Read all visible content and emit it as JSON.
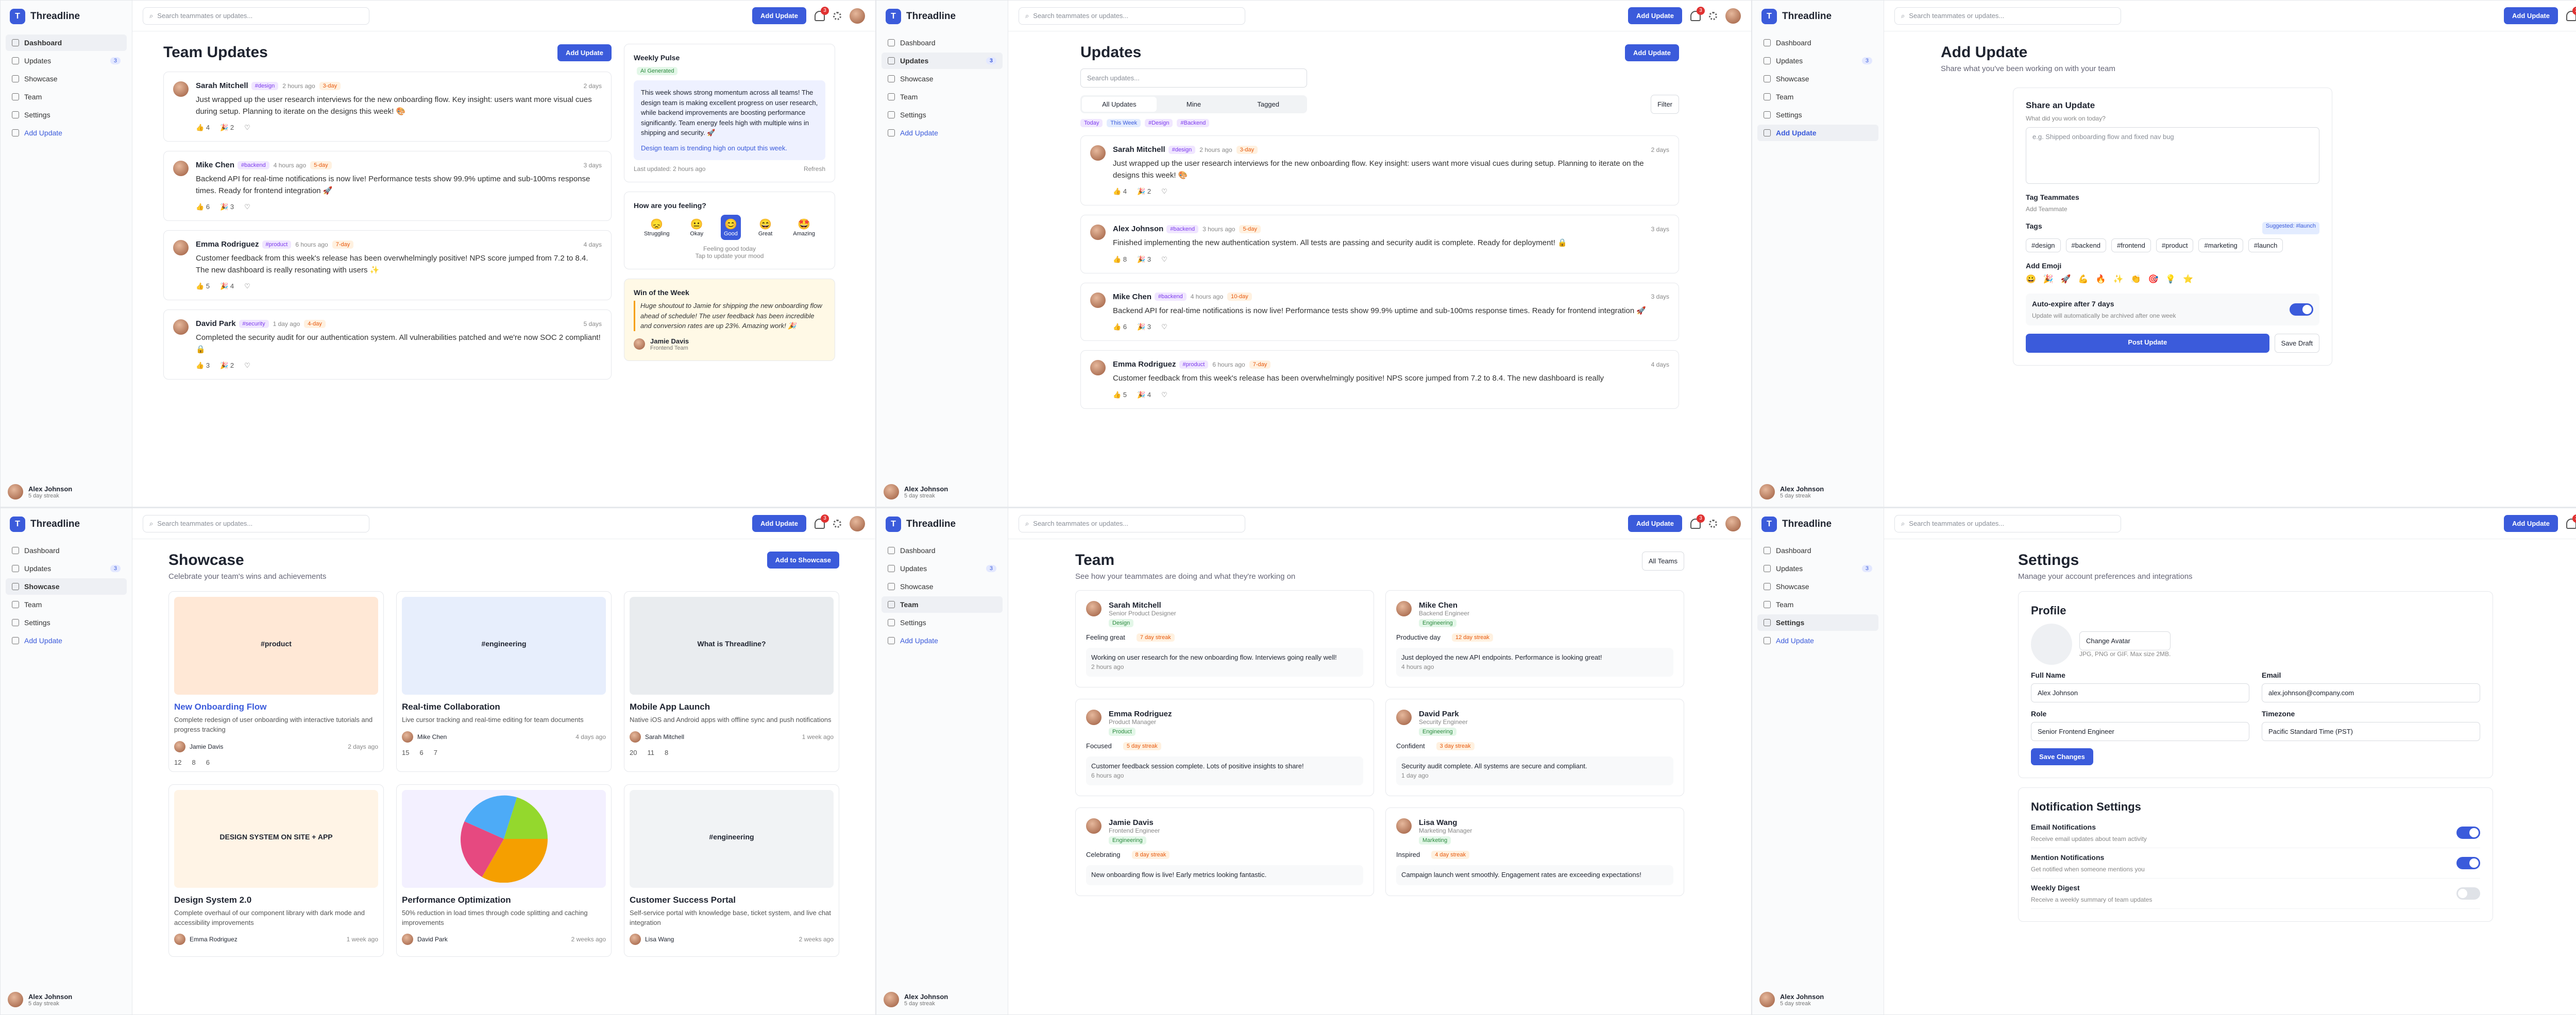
{
  "app": {
    "name": "Threadline",
    "logo_letter": "T",
    "search_placeholder": "Search teammates or updates...",
    "add_update": "Add Update",
    "notif_count": "3",
    "user_name": "Alex Johnson",
    "user_streak": "5 day streak"
  },
  "nav": {
    "items": [
      "Dashboard",
      "Updates",
      "Showcase",
      "Team",
      "Settings"
    ],
    "updates_badge": "3",
    "add": "Add Update"
  },
  "dashboard": {
    "title": "Team Updates",
    "add": "Add Update",
    "posts": [
      {
        "name": "Sarah Mitchell",
        "tag": "#design",
        "time": "2 hours ago",
        "streak": "3-day",
        "ago": "2 days",
        "text": "Just wrapped up the user research interviews for the new onboarding flow. Key insight: users want more visual cues during setup. Planning to iterate on the designs this week! 🎨",
        "r1": "4",
        "r2": "2"
      },
      {
        "name": "Mike Chen",
        "tag": "#backend",
        "time": "4 hours ago",
        "streak": "5-day",
        "ago": "3 days",
        "text": "Backend API for real-time notifications is now live! Performance tests show 99.9% uptime and sub-100ms response times. Ready for frontend integration 🚀",
        "r1": "6",
        "r2": "3"
      },
      {
        "name": "Emma Rodriguez",
        "tag": "#product",
        "time": "6 hours ago",
        "streak": "7-day",
        "ago": "4 days",
        "text": "Customer feedback from this week's release has been overwhelmingly positive! NPS score jumped from 7.2 to 8.4. The new dashboard is really resonating with users ✨",
        "r1": "5",
        "r2": "4"
      },
      {
        "name": "David Park",
        "tag": "#security",
        "time": "1 day ago",
        "streak": "4-day",
        "ago": "5 days",
        "text": "Completed the security audit for our authentication system. All vulnerabilities patched and we're now SOC 2 compliant! 🔒",
        "r1": "3",
        "r2": "2"
      }
    ],
    "pulse": {
      "title": "Weekly Pulse",
      "badge": "AI Generated",
      "text": "This week shows strong momentum across all teams! The design team is making excellent progress on user research, while backend improvements are boosting performance significantly. Team energy feels high with multiple wins in shipping and security. 🚀",
      "trend": "Design team is trending high on output this week.",
      "updated": "Last updated: 2 hours ago",
      "refresh": "Refresh"
    },
    "feeling": {
      "title": "How are you feeling?",
      "options": [
        "Struggling",
        "Okay",
        "Good",
        "Great",
        "Amazing"
      ],
      "caption": "Feeling good today",
      "hint": "Tap to update your mood"
    },
    "win": {
      "title": "Win of the Week",
      "text": "Huge shoutout to Jamie for shipping the new onboarding flow ahead of schedule! The user feedback has been incredible and conversion rates are up 23%. Amazing work! 🎉",
      "name": "Jamie Davis",
      "role": "Frontend Team"
    }
  },
  "updates": {
    "title": "Updates",
    "add": "Add Update",
    "search": "Search updates...",
    "tabs": [
      "All Updates",
      "Mine",
      "Tagged"
    ],
    "filter": "Filter",
    "chips": [
      "Today",
      "This Week",
      "#Design",
      "#Backend"
    ],
    "posts": [
      {
        "name": "Sarah Mitchell",
        "tag": "#design",
        "time": "2 hours ago",
        "streak": "3-day",
        "ago": "2 days",
        "text": "Just wrapped up the user research interviews for the new onboarding flow. Key insight: users want more visual cues during setup. Planning to iterate on the designs this week! 🎨",
        "r1": "4",
        "r2": "2"
      },
      {
        "name": "Alex Johnson",
        "tag": "#backend",
        "time": "3 hours ago",
        "streak": "5-day",
        "ago": "3 days",
        "text": "Finished implementing the new authentication system. All tests are passing and security audit is complete. Ready for deployment! 🔒",
        "r1": "8",
        "r2": "3"
      },
      {
        "name": "Mike Chen",
        "tag": "#backend",
        "time": "4 hours ago",
        "streak": "10-day",
        "ago": "3 days",
        "text": "Backend API for real-time notifications is now live! Performance tests show 99.9% uptime and sub-100ms response times. Ready for frontend integration 🚀",
        "r1": "6",
        "r2": "3"
      },
      {
        "name": "Emma Rodriguez",
        "tag": "#product",
        "time": "6 hours ago",
        "streak": "7-day",
        "ago": "4 days",
        "text": "Customer feedback from this week's release has been overwhelmingly positive! NPS score jumped from 7.2 to 8.4. The new dashboard is really",
        "r1": "5",
        "r2": "4"
      }
    ]
  },
  "add": {
    "title": "Add Update",
    "sub": "Share what you've been working on with your team",
    "card": "Share an Update",
    "q": "What did you work on today?",
    "ph": "e.g. Shipped onboarding flow and fixed nav bug",
    "tag_mates": "Tag Teammates",
    "add_mate": "Add Teammate",
    "tags": "Tags",
    "suggested": "Suggested: #launch",
    "tag_list": [
      "#design",
      "#backend",
      "#frontend",
      "#product",
      "#marketing",
      "#launch"
    ],
    "emoji": "Add Emoji",
    "emojis": [
      "😀",
      "🎉",
      "🚀",
      "💪",
      "🔥",
      "✨",
      "👏",
      "🎯",
      "💡",
      "⭐"
    ],
    "expire": "Auto-expire after 7 days",
    "expire_sub": "Update will automatically be archived after one week",
    "post": "Post Update",
    "draft": "Save Draft"
  },
  "showcase": {
    "title": "Showcase",
    "sub": "Celebrate your team's wins and achievements",
    "add": "Add to Showcase",
    "items": [
      {
        "title": "New Onboarding Flow",
        "desc": "Complete redesign of user onboarding with interactive tutorials and progress tracking",
        "who": "Jamie Davis",
        "ago": "2 days ago",
        "a": "12",
        "b": "8",
        "c": "6",
        "thumb": "#product"
      },
      {
        "title": "Real-time Collaboration",
        "desc": "Live cursor tracking and real-time editing for team documents",
        "who": "Mike Chen",
        "ago": "4 days ago",
        "a": "15",
        "b": "6",
        "c": "7",
        "thumb": "#engineering"
      },
      {
        "title": "Mobile App Launch",
        "desc": "Native iOS and Android apps with offline sync and push notifications",
        "who": "Sarah Mitchell",
        "ago": "1 week ago",
        "a": "20",
        "b": "11",
        "c": "8",
        "thumb": "What is Threadline?"
      },
      {
        "title": "Design System 2.0",
        "desc": "Complete overhaul of our component library with dark mode and accessibility improvements",
        "who": "Emma Rodriguez",
        "ago": "1 week ago",
        "a": "",
        "b": "",
        "c": "",
        "thumb": "DESIGN SYSTEM ON SITE + APP"
      },
      {
        "title": "Performance Optimization",
        "desc": "50% reduction in load times through code splitting and caching improvements",
        "who": "David Park",
        "ago": "2 weeks ago",
        "a": "",
        "b": "",
        "c": "",
        "thumb": ""
      },
      {
        "title": "Customer Success Portal",
        "desc": "Self-service portal with knowledge base, ticket system, and live chat integration",
        "who": "Lisa Wang",
        "ago": "2 weeks ago",
        "a": "",
        "b": "",
        "c": "",
        "thumb": "#engineering"
      }
    ]
  },
  "team": {
    "title": "Team",
    "sub": "See how your teammates are doing and what they're working on",
    "filter": "All Teams",
    "members": [
      {
        "name": "Sarah Mitchell",
        "role": "Senior Product Designer",
        "dept": "Design",
        "mood": "Feeling great",
        "streak": "7 day streak",
        "note": "Working on user research for the new onboarding flow. Interviews going really well!",
        "ago": "2 hours ago"
      },
      {
        "name": "Mike Chen",
        "role": "Backend Engineer",
        "dept": "Engineering",
        "mood": "Productive day",
        "streak": "12 day streak",
        "note": "Just deployed the new API endpoints. Performance is looking great!",
        "ago": "4 hours ago"
      },
      {
        "name": "Emma Rodriguez",
        "role": "Product Manager",
        "dept": "Product",
        "mood": "Focused",
        "streak": "5 day streak",
        "note": "Customer feedback session complete. Lots of positive insights to share!",
        "ago": "6 hours ago"
      },
      {
        "name": "David Park",
        "role": "Security Engineer",
        "dept": "Engineering",
        "mood": "Confident",
        "streak": "3 day streak",
        "note": "Security audit complete. All systems are secure and compliant.",
        "ago": "1 day ago"
      },
      {
        "name": "Jamie Davis",
        "role": "Frontend Engineer",
        "dept": "Engineering",
        "mood": "Celebrating",
        "streak": "8 day streak",
        "note": "New onboarding flow is live! Early metrics looking fantastic.",
        "ago": ""
      },
      {
        "name": "Lisa Wang",
        "role": "Marketing Manager",
        "dept": "Marketing",
        "mood": "Inspired",
        "streak": "4 day streak",
        "note": "Campaign launch went smoothly. Engagement rates are exceeding expectations!",
        "ago": ""
      }
    ]
  },
  "settings": {
    "title": "Settings",
    "sub": "Manage your account preferences and integrations",
    "profile": "Profile",
    "change_avatar": "Change Avatar",
    "avatar_hint": "JPG, PNG or GIF. Max size 2MB.",
    "full_name": "Full Name",
    "full_name_v": "Alex Johnson",
    "email": "Email",
    "email_v": "alex.johnson@company.com",
    "role": "Role",
    "role_v": "Senior Frontend Engineer",
    "tz": "Timezone",
    "tz_v": "Pacific Standard Time (PST)",
    "save": "Save Changes",
    "notif": "Notification Settings",
    "toggles": [
      {
        "t": "Email Notifications",
        "s": "Receive email updates about team activity"
      },
      {
        "t": "Mention Notifications",
        "s": "Get notified when someone mentions you"
      },
      {
        "t": "Weekly Digest",
        "s": "Receive a weekly summary of team updates"
      }
    ]
  }
}
